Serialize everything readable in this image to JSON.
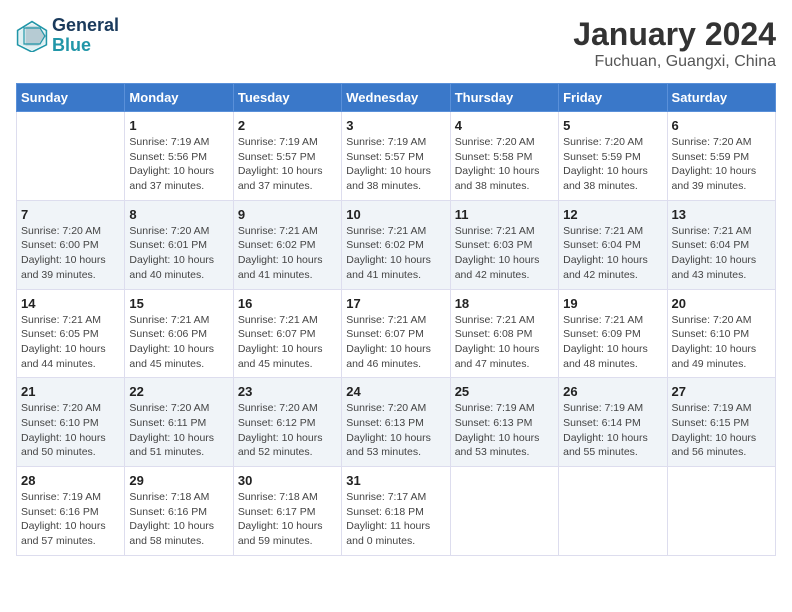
{
  "header": {
    "logo_line1": "General",
    "logo_line2": "Blue",
    "title": "January 2024",
    "subtitle": "Fuchuan, Guangxi, China"
  },
  "days_of_week": [
    "Sunday",
    "Monday",
    "Tuesday",
    "Wednesday",
    "Thursday",
    "Friday",
    "Saturday"
  ],
  "weeks": [
    [
      {
        "day": "",
        "info": ""
      },
      {
        "day": "1",
        "info": "Sunrise: 7:19 AM\nSunset: 5:56 PM\nDaylight: 10 hours\nand 37 minutes."
      },
      {
        "day": "2",
        "info": "Sunrise: 7:19 AM\nSunset: 5:57 PM\nDaylight: 10 hours\nand 37 minutes."
      },
      {
        "day": "3",
        "info": "Sunrise: 7:19 AM\nSunset: 5:57 PM\nDaylight: 10 hours\nand 38 minutes."
      },
      {
        "day": "4",
        "info": "Sunrise: 7:20 AM\nSunset: 5:58 PM\nDaylight: 10 hours\nand 38 minutes."
      },
      {
        "day": "5",
        "info": "Sunrise: 7:20 AM\nSunset: 5:59 PM\nDaylight: 10 hours\nand 38 minutes."
      },
      {
        "day": "6",
        "info": "Sunrise: 7:20 AM\nSunset: 5:59 PM\nDaylight: 10 hours\nand 39 minutes."
      }
    ],
    [
      {
        "day": "7",
        "info": "Sunrise: 7:20 AM\nSunset: 6:00 PM\nDaylight: 10 hours\nand 39 minutes."
      },
      {
        "day": "8",
        "info": "Sunrise: 7:20 AM\nSunset: 6:01 PM\nDaylight: 10 hours\nand 40 minutes."
      },
      {
        "day": "9",
        "info": "Sunrise: 7:21 AM\nSunset: 6:02 PM\nDaylight: 10 hours\nand 41 minutes."
      },
      {
        "day": "10",
        "info": "Sunrise: 7:21 AM\nSunset: 6:02 PM\nDaylight: 10 hours\nand 41 minutes."
      },
      {
        "day": "11",
        "info": "Sunrise: 7:21 AM\nSunset: 6:03 PM\nDaylight: 10 hours\nand 42 minutes."
      },
      {
        "day": "12",
        "info": "Sunrise: 7:21 AM\nSunset: 6:04 PM\nDaylight: 10 hours\nand 42 minutes."
      },
      {
        "day": "13",
        "info": "Sunrise: 7:21 AM\nSunset: 6:04 PM\nDaylight: 10 hours\nand 43 minutes."
      }
    ],
    [
      {
        "day": "14",
        "info": "Sunrise: 7:21 AM\nSunset: 6:05 PM\nDaylight: 10 hours\nand 44 minutes."
      },
      {
        "day": "15",
        "info": "Sunrise: 7:21 AM\nSunset: 6:06 PM\nDaylight: 10 hours\nand 45 minutes."
      },
      {
        "day": "16",
        "info": "Sunrise: 7:21 AM\nSunset: 6:07 PM\nDaylight: 10 hours\nand 45 minutes."
      },
      {
        "day": "17",
        "info": "Sunrise: 7:21 AM\nSunset: 6:07 PM\nDaylight: 10 hours\nand 46 minutes."
      },
      {
        "day": "18",
        "info": "Sunrise: 7:21 AM\nSunset: 6:08 PM\nDaylight: 10 hours\nand 47 minutes."
      },
      {
        "day": "19",
        "info": "Sunrise: 7:21 AM\nSunset: 6:09 PM\nDaylight: 10 hours\nand 48 minutes."
      },
      {
        "day": "20",
        "info": "Sunrise: 7:20 AM\nSunset: 6:10 PM\nDaylight: 10 hours\nand 49 minutes."
      }
    ],
    [
      {
        "day": "21",
        "info": "Sunrise: 7:20 AM\nSunset: 6:10 PM\nDaylight: 10 hours\nand 50 minutes."
      },
      {
        "day": "22",
        "info": "Sunrise: 7:20 AM\nSunset: 6:11 PM\nDaylight: 10 hours\nand 51 minutes."
      },
      {
        "day": "23",
        "info": "Sunrise: 7:20 AM\nSunset: 6:12 PM\nDaylight: 10 hours\nand 52 minutes."
      },
      {
        "day": "24",
        "info": "Sunrise: 7:20 AM\nSunset: 6:13 PM\nDaylight: 10 hours\nand 53 minutes."
      },
      {
        "day": "25",
        "info": "Sunrise: 7:19 AM\nSunset: 6:13 PM\nDaylight: 10 hours\nand 53 minutes."
      },
      {
        "day": "26",
        "info": "Sunrise: 7:19 AM\nSunset: 6:14 PM\nDaylight: 10 hours\nand 55 minutes."
      },
      {
        "day": "27",
        "info": "Sunrise: 7:19 AM\nSunset: 6:15 PM\nDaylight: 10 hours\nand 56 minutes."
      }
    ],
    [
      {
        "day": "28",
        "info": "Sunrise: 7:19 AM\nSunset: 6:16 PM\nDaylight: 10 hours\nand 57 minutes."
      },
      {
        "day": "29",
        "info": "Sunrise: 7:18 AM\nSunset: 6:16 PM\nDaylight: 10 hours\nand 58 minutes."
      },
      {
        "day": "30",
        "info": "Sunrise: 7:18 AM\nSunset: 6:17 PM\nDaylight: 10 hours\nand 59 minutes."
      },
      {
        "day": "31",
        "info": "Sunrise: 7:17 AM\nSunset: 6:18 PM\nDaylight: 11 hours\nand 0 minutes."
      },
      {
        "day": "",
        "info": ""
      },
      {
        "day": "",
        "info": ""
      },
      {
        "day": "",
        "info": ""
      }
    ]
  ]
}
